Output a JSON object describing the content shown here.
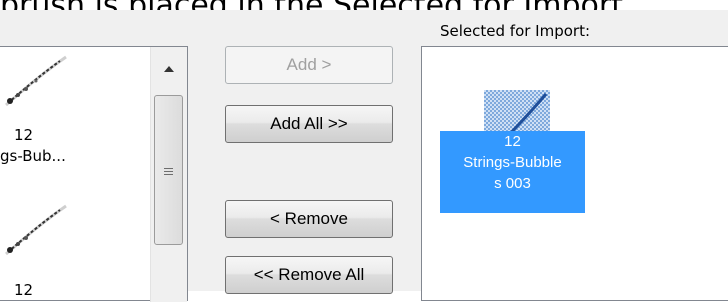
{
  "caption": "brush is placed in the Selected for Import",
  "left_list": {
    "items": [
      {
        "line1": "12",
        "line2": "gs-Bub..."
      },
      {
        "line1": "12",
        "line2": ""
      }
    ]
  },
  "buttons": {
    "add": "Add >",
    "add_all": "Add All >>",
    "remove": "< Remove",
    "remove_all": "<< Remove All"
  },
  "right": {
    "label": "Selected for Import:",
    "selected_item": {
      "line1": "12",
      "line2": "Strings-Bubble",
      "line3": "s 003"
    }
  },
  "icons": {
    "scroll_up": "triangle-up-icon",
    "scroll_grip": "grip-lines-icon",
    "brush_thumb": "brush-stroke-icon"
  },
  "colors": {
    "selection": "#3399ff",
    "window_bg": "#f0f0f0"
  }
}
